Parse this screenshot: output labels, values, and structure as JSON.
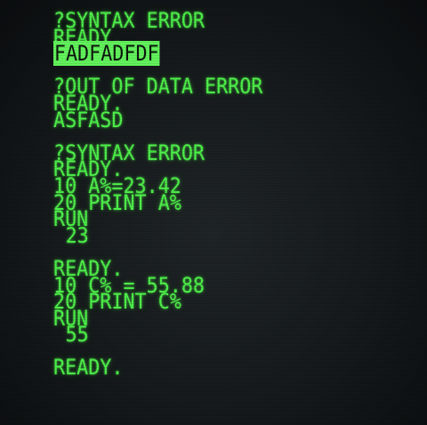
{
  "screen": {
    "lines": [
      {
        "text": "?SYNTAX ERROR",
        "style": "normal"
      },
      {
        "text": "READY.",
        "style": "normal"
      },
      {
        "text": "FADFADFDF",
        "style": "inverse"
      },
      {
        "text": "",
        "style": "blank"
      },
      {
        "text": "?OUT OF DATA ERROR",
        "style": "normal"
      },
      {
        "text": "READY.",
        "style": "normal"
      },
      {
        "text": "ASFASD",
        "style": "normal"
      },
      {
        "text": "",
        "style": "blank"
      },
      {
        "text": "?SYNTAX ERROR",
        "style": "normal"
      },
      {
        "text": "READY.",
        "style": "normal"
      },
      {
        "text": "10 A%=23.42",
        "style": "normal"
      },
      {
        "text": "20 PRINT A%",
        "style": "normal"
      },
      {
        "text": "RUN",
        "style": "normal"
      },
      {
        "text": "23",
        "style": "indent"
      },
      {
        "text": "",
        "style": "blank"
      },
      {
        "text": "READY.",
        "style": "normal"
      },
      {
        "text": "10 C% = 55.88",
        "style": "normal"
      },
      {
        "text": "20 PRINT C%",
        "style": "normal"
      },
      {
        "text": "RUN",
        "style": "normal"
      },
      {
        "text": "55",
        "style": "indent"
      },
      {
        "text": "",
        "style": "blank"
      },
      {
        "text": "READY.",
        "style": "normal"
      }
    ],
    "colors": {
      "phosphor": "#4ef04a",
      "background": "#15191b",
      "inverse_background": "#62f25c"
    }
  }
}
